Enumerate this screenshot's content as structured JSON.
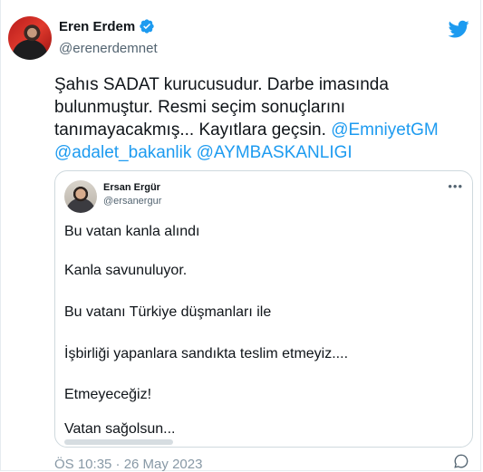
{
  "tweet": {
    "author_name": "Eren Erdem",
    "author_handle": "@erenerdemnet",
    "text_plain": "Şahıs SADAT kurucusudur. Darbe imasında bulunmuştur. Resmi seçim sonuçlarını tanımayacakmış... Kayıtlara geçsin.",
    "mention_1": "@EmniyetGM",
    "mention_2": "@adalet_bakanlik",
    "mention_3": "@AYMBASKANLIGI",
    "timestamp": "ÖS 10:35 · 26 May 2023"
  },
  "quoted": {
    "author_name": "Ersan Ergür",
    "author_handle": "@ersanergur",
    "more": "•••",
    "lines": [
      "Bu vatan kanla alındı",
      "Kanla savunuluyor.",
      "Bu vatanı Türkiye düşmanları ile",
      "İşbirliği yapanlara sandıkta teslim etmeyiz....",
      "Etmeyeceğiz!",
      "Vatan sağolsun..."
    ]
  },
  "colors": {
    "brand": "#1d9bf0",
    "text": "#0f1419",
    "muted": "#536471",
    "border": "#cfd9de"
  },
  "icons": {
    "verified": "verified-badge-icon",
    "brand": "twitter-bird-icon",
    "more": "more-options-icon",
    "reply": "reply-icon"
  }
}
